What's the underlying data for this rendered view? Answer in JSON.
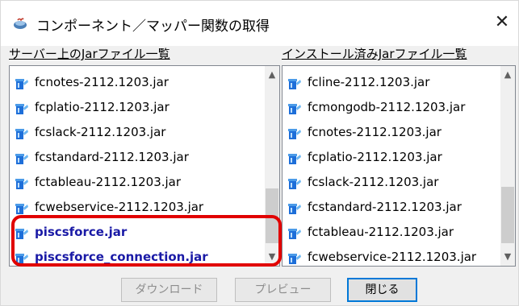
{
  "window": {
    "title": "コンポーネント／マッパー関数の取得",
    "close_glyph": "✕",
    "icon": "java-cup-icon"
  },
  "left_panel": {
    "header": "サーバー上のJarファイル一覧",
    "items": [
      {
        "label": "fcnotes-2112.1203.jar",
        "bold": false
      },
      {
        "label": "fcplatio-2112.1203.jar",
        "bold": false
      },
      {
        "label": "fcslack-2112.1203.jar",
        "bold": false
      },
      {
        "label": "fcstandard-2112.1203.jar",
        "bold": false
      },
      {
        "label": "fctableau-2112.1203.jar",
        "bold": false
      },
      {
        "label": "fcwebservice-2112.1203.jar",
        "bold": false
      },
      {
        "label": "piscsforce.jar",
        "bold": true
      },
      {
        "label": "piscsforce_connection.jar",
        "bold": true
      }
    ]
  },
  "right_panel": {
    "header": "インストール済みJarファイル一覧",
    "items": [
      {
        "label": "fcline-2112.1203.jar"
      },
      {
        "label": "fcmongodb-2112.1203.jar"
      },
      {
        "label": "fcnotes-2112.1203.jar"
      },
      {
        "label": "fcplatio-2112.1203.jar"
      },
      {
        "label": "fcslack-2112.1203.jar"
      },
      {
        "label": "fcstandard-2112.1203.jar"
      },
      {
        "label": "fctableau-2112.1203.jar"
      },
      {
        "label": "fcwebservice-2112.1203.jar"
      }
    ]
  },
  "buttons": {
    "download": "ダウンロード",
    "preview": "プレビュー",
    "close": "閉じる"
  },
  "colors": {
    "highlight": "#e10000",
    "bold_item": "#1a1aa6",
    "jar_icon_blue": "#1e6fd9"
  }
}
